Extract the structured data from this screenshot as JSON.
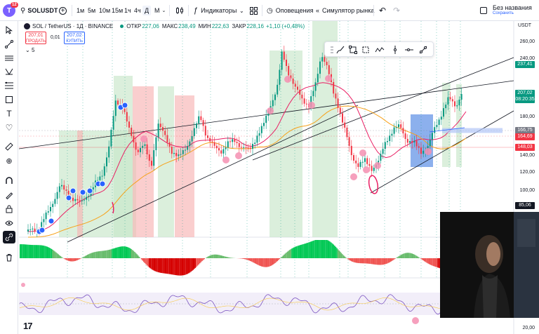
{
  "topbar": {
    "avatar_letter": "T",
    "notification_count": "12",
    "symbol": "SOLUSDT",
    "add_symbol_icon": "plus-circle-icon",
    "intervals": [
      "1м",
      "5м",
      "10м",
      "15м",
      "1ч",
      "4ч",
      "Д",
      "М"
    ],
    "active_interval": "Д",
    "indicators_label": "Индикаторы",
    "alerts_label": "Оповещения",
    "replay_label": "Симулятор рынка",
    "layout_name": "Без названия",
    "layout_status": "Сохранить"
  },
  "legend": {
    "title": "SOL / TetherUS · 1Д · BINANCE",
    "open_label": "ОТКР",
    "open": "227,06",
    "high_label": "МАКС",
    "high": "238,49",
    "low_label": "МИН",
    "low": "222,63",
    "close_label": "ЗАКР",
    "close": "228,16",
    "change": "+1,10 (+0,48%)",
    "sell_price": "207,01",
    "sell_label": "ПРОДАТЬ",
    "spread": "0,01",
    "buy_price": "207,02",
    "buy_label": "КУПИТЬ",
    "indicator_count": "5"
  },
  "price_axis": {
    "currency": "USDT",
    "ticks": [
      "260,00",
      "240,00",
      "220,00",
      "200,00",
      "180,00",
      "160,00",
      "140,00",
      "120,00",
      "100,00",
      "80,00"
    ],
    "tags": [
      {
        "value": "237,41",
        "color": "#089981"
      },
      {
        "value": "207,02",
        "color": "#089981"
      },
      {
        "value": "08:20:35",
        "color": "#089981"
      },
      {
        "value": "166,75",
        "color": "#787b86"
      },
      {
        "value": "164,69",
        "color": "#f23645"
      },
      {
        "value": "148,03",
        "color": "#f23645"
      },
      {
        "value": "85,06",
        "color": "#131722"
      }
    ],
    "bottom_tick": "20,00"
  },
  "colors": {
    "up": "#089981",
    "down": "#f23645",
    "accent": "#2962ff",
    "zone_green": "#c8e6c9",
    "zone_red": "#f7b4b4",
    "zone_blue": "#5b8fe6"
  }
}
